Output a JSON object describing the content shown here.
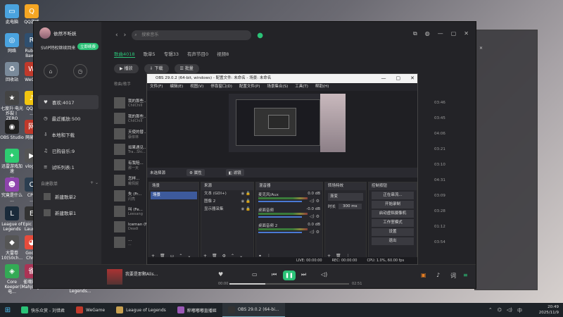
{
  "desktop": {
    "icons": [
      {
        "label": "此电脑",
        "color": "#4aa3df",
        "glyph": "▭"
      },
      {
        "label": "QQ游戏",
        "color": "#f5a623",
        "glyph": "Q"
      },
      {
        "label": "网络",
        "color": "#4aa3df",
        "glyph": "◎"
      },
      {
        "label": "Rubi...\nBaw...",
        "color": "#2f4f6f",
        "glyph": "R"
      },
      {
        "label": "回收站",
        "color": "#7a8a9a",
        "glyph": "♻"
      },
      {
        "label": "WeG...",
        "color": "#c0392b",
        "glyph": "W"
      },
      {
        "label": "七度升·电光\n炸裂丨ZERO",
        "color": "#444",
        "glyph": "★"
      },
      {
        "label": "QQ音\n...",
        "color": "#f1c40f",
        "glyph": "♪"
      },
      {
        "label": "OBS Studio",
        "color": "#222",
        "glyph": "◉"
      },
      {
        "label": "网易...",
        "color": "#c0392b",
        "glyph": "网"
      },
      {
        "label": "迅雷游戏加速\n...",
        "color": "#2ecc71",
        "glyph": "✦"
      },
      {
        "label": "vlog...",
        "color": "#555",
        "glyph": "▶"
      },
      {
        "label": "究竟是什么\n...",
        "color": "#8e44ad",
        "glyph": "☻"
      },
      {
        "label": "CPU\n...",
        "color": "#2c3e50",
        "glyph": "C"
      },
      {
        "label": "League of\nLegends",
        "color": "#1a2a3a",
        "glyph": "L"
      },
      {
        "label": "Epic G...\nLaun...",
        "color": "#333",
        "glyph": "E"
      },
      {
        "label": "大雷卷\n10(50ch...",
        "color": "#555",
        "glyph": "◆"
      },
      {
        "label": "Goo...\nChr...",
        "color": "#e74c3c",
        "glyph": "◕"
      },
      {
        "label": "Core\nKeeper 电...",
        "color": "#3a5",
        "glyph": "◈"
      },
      {
        "label": "雀魂麻将\n(Mahjong...",
        "color": "#a35",
        "glyph": "雀"
      }
    ],
    "bottom_label": "Legends..."
  },
  "music": {
    "user_name": "依然不听妖",
    "vip_text": "SVIP特权继续回来",
    "vip_button": "立即续费",
    "nav_items": [
      {
        "label": "喜欢:4017",
        "icon": "♥",
        "active": true
      },
      {
        "label": "最近播放:500",
        "icon": "◷",
        "active": false
      },
      {
        "label": "本地和下载",
        "icon": "⇩",
        "active": false
      },
      {
        "label": "已购音乐:9",
        "icon": "♫",
        "active": false
      },
      {
        "label": "试听列表:1",
        "icon": "≡",
        "active": false
      }
    ],
    "section_label": "自建歌单",
    "playlists": [
      {
        "label": "新建歌单2"
      },
      {
        "label": "新建歌单1"
      }
    ],
    "search_placeholder": "搜索音乐",
    "tabs": [
      "歌曲4018",
      "歌单5",
      "专辑33",
      "有声节目0",
      "视频8"
    ],
    "buttons": {
      "play": "播放",
      "download": "下载",
      "batch": "批量"
    },
    "column_header": "歌曲/歌手",
    "songs": [
      {
        "title": "我的那些...",
        "artist": "ChilChill",
        "duration": "03:46"
      },
      {
        "title": "我的那些...",
        "artist": "ChilChill",
        "duration": "03:45"
      },
      {
        "title": "天使的替...",
        "artist": "蔡依林",
        "duration": "04:06"
      },
      {
        "title": "如果遇见...",
        "artist": "Tra...Shi...",
        "duration": "03:21"
      },
      {
        "title": "有我陪...",
        "artist": "那一天",
        "duration": "03:10"
      },
      {
        "title": "怎样...",
        "artist": "戴佩妮",
        "duration": "04:31"
      },
      {
        "title": "失 (Fr...",
        "artist": "闪亮",
        "duration": "03:09"
      },
      {
        "title": "叫 (Fe...",
        "artist": "Leesang",
        "duration": "03:28"
      },
      {
        "title": "Iceman (Fo...",
        "artist": "Deadi",
        "duration": "01:12"
      },
      {
        "title": "...",
        "artist": "...",
        "duration": "03:54"
      }
    ],
    "player": {
      "title": "我要是那颗Alis...",
      "time_left": "00:00",
      "time_right": "02:51"
    }
  },
  "obs": {
    "title": "OBS 29.0.2 (64-bit, windows) - 配置文件: 未命名 - 场景: 未命名",
    "menu": [
      "文件(F)",
      "编辑(E)",
      "视图(V)",
      "停靠窗口(D)",
      "配置文件(P)",
      "场景集合(S)",
      "工具(T)",
      "帮助(H)"
    ],
    "source_bar": {
      "label": "未选择源",
      "properties": "属性",
      "filters": "滤镜"
    },
    "panels": {
      "scenes": "场景",
      "sources": "来源",
      "mixer": "混音器",
      "transitions": "转场特效",
      "controls": "控制按钮"
    },
    "scene_item": "场景",
    "sources": [
      {
        "label": "文本 (GDI+)"
      },
      {
        "label": "图像 2"
      },
      {
        "label": "显示器采集"
      }
    ],
    "mixer": [
      {
        "label": "麦克风/Aux",
        "db": "0.0 dB"
      },
      {
        "label": "桌面音频",
        "db": "-0.0 dB"
      },
      {
        "label": "桌面音频 2",
        "db": "0.0 dB"
      }
    ],
    "transition": {
      "type": "渐变",
      "duration_label": "时长",
      "duration_value": "300 ms"
    },
    "controls": [
      "正在串流...",
      "开始录制",
      "启动虚拟摄像机",
      "工作室模式",
      "设置",
      "退出"
    ],
    "status": {
      "live": "LIVE: 00:00:00",
      "rec": "REC: 00:00:00",
      "cpu": "CPU: 1.0%, 60.00 fps"
    }
  },
  "taskbar": {
    "items": [
      {
        "label": "快乐众赏 - 刘惜君",
        "color": "#2bc277",
        "active": false
      },
      {
        "label": "WeGame",
        "color": "#c0392b",
        "active": false
      },
      {
        "label": "League of Legends",
        "color": "#c8a050",
        "active": false
      },
      {
        "label": "粹嘟嘟嘟直播姬",
        "color": "#9b59b6",
        "active": false
      },
      {
        "label": "OBS 29.0.2 (64-bi...",
        "color": "#333",
        "active": true
      }
    ],
    "time": "20:49",
    "date": "2025/11/9"
  }
}
